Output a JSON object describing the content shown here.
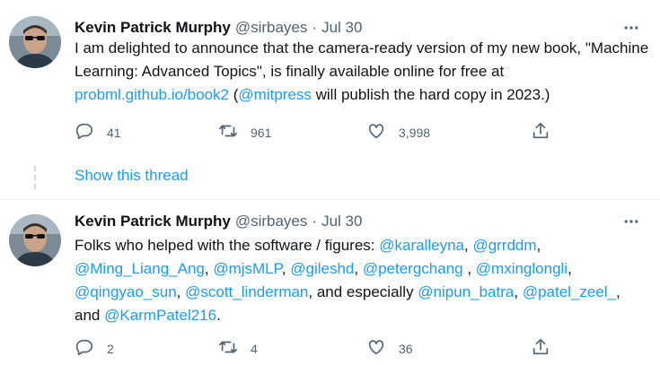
{
  "tweets": [
    {
      "author": {
        "name": "Kevin Patrick Murphy",
        "handle": "@sirbayes"
      },
      "separator": "·",
      "date": "Jul 30",
      "text_segments": [
        {
          "text": "I am delighted to announce that the camera-ready version of my new book, \"Machine Learning: Advanced Topics\", is finally available online for free at ",
          "link": false
        },
        {
          "text": "probml.github.io/book2",
          "link": true
        },
        {
          "text": " (",
          "link": false
        },
        {
          "text": "@mitpress",
          "link": true
        },
        {
          "text": " will publish the hard copy in 2023.)",
          "link": false
        }
      ],
      "stats": {
        "replies": "41",
        "retweets": "961",
        "likes": "3,998"
      }
    },
    {
      "author": {
        "name": "Kevin Patrick Murphy",
        "handle": "@sirbayes"
      },
      "separator": "·",
      "date": "Jul 30",
      "text_segments": [
        {
          "text": "Folks who helped with the software / figures: ",
          "link": false
        },
        {
          "text": "@karalleyna",
          "link": true
        },
        {
          "text": ", ",
          "link": false
        },
        {
          "text": "@grrddm",
          "link": true
        },
        {
          "text": ", ",
          "link": false
        },
        {
          "text": "@Ming_Liang_Ang",
          "link": true
        },
        {
          "text": ", ",
          "link": false
        },
        {
          "text": "@mjsMLP",
          "link": true
        },
        {
          "text": ", ",
          "link": false
        },
        {
          "text": "@gileshd",
          "link": true
        },
        {
          "text": ", ",
          "link": false
        },
        {
          "text": "@petergchang",
          "link": true
        },
        {
          "text": " , ",
          "link": false
        },
        {
          "text": "@mxinglongli",
          "link": true
        },
        {
          "text": ", ",
          "link": false
        },
        {
          "text": "@qingyao_sun",
          "link": true
        },
        {
          "text": ", ",
          "link": false
        },
        {
          "text": "@scott_linderman",
          "link": true
        },
        {
          "text": ", and especially ",
          "link": false
        },
        {
          "text": "@nipun_batra",
          "link": true
        },
        {
          "text": ", ",
          "link": false
        },
        {
          "text": "@patel_zeel_",
          "link": true
        },
        {
          "text": ", and ",
          "link": false
        },
        {
          "text": "@KarmPatel216",
          "link": true
        },
        {
          "text": ".",
          "link": false
        }
      ],
      "stats": {
        "replies": "2",
        "retweets": "4",
        "likes": "36"
      }
    }
  ],
  "show_thread_label": "Show this thread",
  "colors": {
    "link": "#1d9bf0",
    "secondary": "#536471",
    "text": "#0f1419"
  },
  "icons": [
    "reply-icon",
    "retweet-icon",
    "like-icon",
    "share-icon",
    "more-icon"
  ]
}
